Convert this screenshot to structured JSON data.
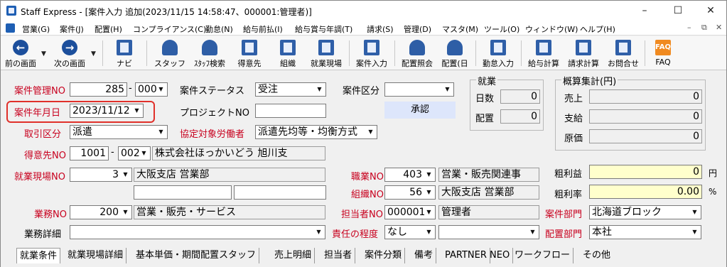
{
  "window": {
    "title": "Staff Express - [案件入力 追加(2023/11/15 14:58:47、000001:管理者)]",
    "controls": [
      "–",
      "☐",
      "✕"
    ]
  },
  "menubar": {
    "items": [
      "営業(G)",
      "案件(J)",
      "配置(H)",
      "コンプライアンス(C)",
      "勤怠(N)",
      "給与前払(I)",
      "給与賞与年調(T)",
      "請求(S)",
      "管理(D)",
      "マスタ(M)",
      "ツール(O)",
      "ウィンドウ(W)",
      "ヘルプ(H)"
    ],
    "mdi": [
      "–",
      "⧉",
      "✕"
    ]
  },
  "toolbar": {
    "buttons": [
      {
        "label": "前の画面",
        "icon": "back-arrow-icon"
      },
      {
        "label": "次の画面",
        "icon": "forward-arrow-icon"
      },
      {
        "label": "ナビ",
        "icon": "navi-icon"
      },
      {
        "label": "スタッフ",
        "icon": "staff-icon"
      },
      {
        "label": "ｽﾀｯﾌ検索",
        "icon": "staff-search-icon"
      },
      {
        "label": "得意先",
        "icon": "client-icon"
      },
      {
        "label": "組織",
        "icon": "organization-icon"
      },
      {
        "label": "就業現場",
        "icon": "worksite-icon"
      },
      {
        "label": "案件入力",
        "icon": "case-input-icon"
      },
      {
        "label": "配置照会",
        "icon": "placement-inquiry-icon"
      },
      {
        "label": "配置(日",
        "icon": "placement-daily-icon"
      },
      {
        "label": "勤怠入力",
        "icon": "attendance-icon"
      },
      {
        "label": "給与計算",
        "icon": "payroll-icon"
      },
      {
        "label": "請求計算",
        "icon": "billing-icon"
      },
      {
        "label": "お問合せ",
        "icon": "inquiry-icon"
      },
      {
        "label": "FAQ",
        "icon": "faq-icon"
      }
    ]
  },
  "form": {
    "case_mgmt_no": {
      "label": "案件管理NO",
      "value": "285",
      "branch": "000"
    },
    "case_status": {
      "label": "案件ステータス",
      "value": "受注"
    },
    "case_category": {
      "label": "案件区分",
      "value": ""
    },
    "case_date": {
      "label": "案件年月日",
      "value": "2023/11/12"
    },
    "project_no": {
      "label": "プロジェクトNO",
      "value": ""
    },
    "approve_button": "承認",
    "transaction_type": {
      "label": "取引区分",
      "value": "派遣"
    },
    "agreement_worker": {
      "label": "協定対象労働者",
      "value": "派遣先均等・均衡方式"
    },
    "client": {
      "label": "得意先NO",
      "code": "1001",
      "branch": "002",
      "name": "株式会社ほっかいどう 旭川支"
    },
    "worksite": {
      "label": "就業現場NO",
      "code": "3",
      "name": "大阪支店 営業部"
    },
    "occupation": {
      "label": "職業NO",
      "code": "403",
      "name": "営業・販売関連事"
    },
    "organization": {
      "label": "組織NO",
      "code": "56",
      "name": "大阪支店 営業部"
    },
    "job": {
      "label": "業務NO",
      "code": "200",
      "name": "営業・販売・サービス"
    },
    "person_in_charge": {
      "label": "担当者NO",
      "code": "000001",
      "name": "管理者"
    },
    "case_department": {
      "label": "案件部門",
      "value": "北海道ブロック"
    },
    "job_detail": {
      "label": "業務詳細",
      "value": ""
    },
    "responsibility": {
      "label": "責任の程度",
      "value": "なし",
      "extra": ""
    },
    "placement_department": {
      "label": "配置部門",
      "value": "本社"
    }
  },
  "employment": {
    "title": "就業",
    "days": {
      "label": "日数",
      "value": "0"
    },
    "placement": {
      "label": "配置",
      "value": "0"
    }
  },
  "summary": {
    "title": "概算集計(円)",
    "sales": {
      "label": "売上",
      "value": "0"
    },
    "payment": {
      "label": "支給",
      "value": "0"
    },
    "cost": {
      "label": "原価",
      "value": "0"
    },
    "gross_profit": {
      "label": "粗利益",
      "value": "0",
      "unit": "円"
    },
    "gross_margin": {
      "label": "粗利率",
      "value": "0.00",
      "unit": "%"
    }
  },
  "tabs": [
    "就業条件",
    "就業現場詳細",
    "基本単価・期間配置スタッフ",
    "売上明細",
    "担当者",
    "案件分類",
    "備考",
    "PARTNER",
    "NEO",
    "ワークフロー",
    "その他"
  ],
  "colors": {
    "required_label": "#c8001e",
    "highlight": "#e0302a",
    "profit_field": "#ffffcc",
    "approve_button": "#dde6fb"
  }
}
